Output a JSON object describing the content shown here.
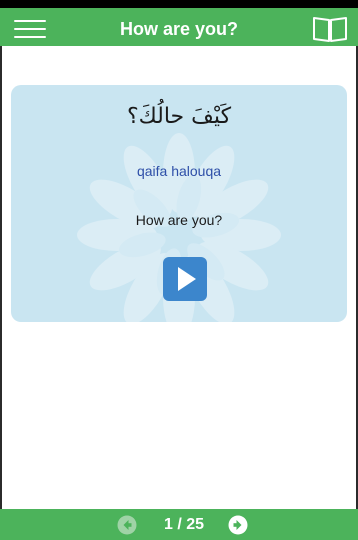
{
  "header": {
    "title": "How are you?",
    "menu_icon": "hamburger-menu-icon",
    "book_icon": "open-book-icon"
  },
  "card": {
    "arabic": "كَيْفَ حالُكَ؟",
    "transliteration": "qaifa halouqa",
    "english": "How are you?",
    "play_icon": "play-icon"
  },
  "footer": {
    "prev_icon": "arrow-left-circle-icon",
    "next_icon": "arrow-right-circle-icon",
    "pager": "1 / 25"
  },
  "colors": {
    "green": "#4cb35b",
    "card_bg": "#c9e5f1",
    "transliteration": "#2e4fa8",
    "play_button": "#3c86cc"
  }
}
